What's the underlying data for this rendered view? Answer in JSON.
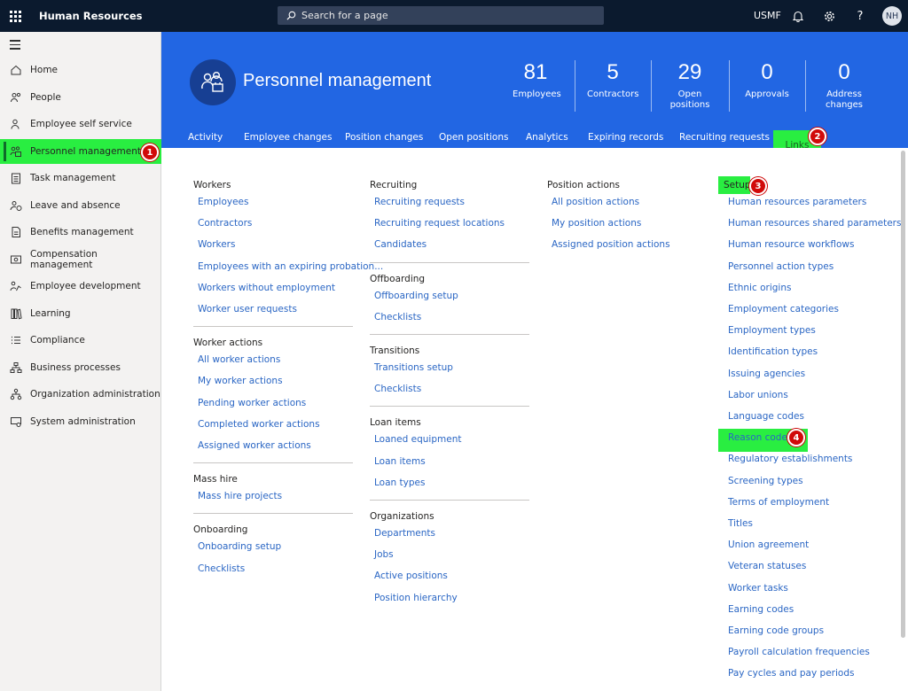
{
  "app": {
    "title": "Human Resources",
    "search_placeholder": "Search for a page",
    "company": "USMF",
    "user_initials": "NH"
  },
  "sidenav": {
    "items": [
      {
        "label": "Home",
        "icon": "home-icon"
      },
      {
        "label": "People",
        "icon": "people-icon"
      },
      {
        "label": "Employee self service",
        "icon": "person-icon"
      },
      {
        "label": "Personnel management",
        "icon": "personnel-icon",
        "active": true
      },
      {
        "label": "Task management",
        "icon": "clipboard-icon"
      },
      {
        "label": "Leave and absence",
        "icon": "person-clock-icon"
      },
      {
        "label": "Benefits management",
        "icon": "document-icon"
      },
      {
        "label": "Compensation management",
        "icon": "money-icon"
      },
      {
        "label": "Employee development",
        "icon": "growth-icon"
      },
      {
        "label": "Learning",
        "icon": "books-icon"
      },
      {
        "label": "Compliance",
        "icon": "list-icon"
      },
      {
        "label": "Business processes",
        "icon": "flow-icon"
      },
      {
        "label": "Organization administration",
        "icon": "org-icon"
      },
      {
        "label": "System administration",
        "icon": "system-icon"
      }
    ]
  },
  "banner": {
    "title": "Personnel management",
    "kpis": [
      {
        "value": "81",
        "label": "Employees"
      },
      {
        "value": "5",
        "label": "Contractors"
      },
      {
        "value": "29",
        "label": "Open positions"
      },
      {
        "value": "0",
        "label": "Approvals"
      },
      {
        "value": "0",
        "label_line1": "Address",
        "label_line2": "changes"
      }
    ],
    "tabs": [
      "Activity",
      "Employee changes",
      "Position changes",
      "Open positions",
      "Analytics",
      "Expiring records",
      "Recruiting requests",
      "Links"
    ]
  },
  "badges": [
    "1",
    "2",
    "3",
    "4"
  ],
  "links": {
    "col1": [
      {
        "title": "Workers",
        "items": [
          "Employees",
          "Contractors",
          "Workers",
          "Employees with an expiring probation...",
          "Workers without employment",
          "Worker user requests"
        ]
      },
      {
        "title": "Worker actions",
        "items": [
          "All worker actions",
          "My worker actions",
          "Pending worker actions",
          "Completed worker actions",
          "Assigned worker actions"
        ]
      },
      {
        "title": "Mass hire",
        "items": [
          "Mass hire projects"
        ]
      },
      {
        "title": "Onboarding",
        "items": [
          "Onboarding setup",
          "Checklists"
        ]
      }
    ],
    "col2": [
      {
        "title": "Recruiting",
        "items": [
          "Recruiting requests",
          "Recruiting request locations",
          "Candidates"
        ]
      },
      {
        "title": "Offboarding",
        "items": [
          "Offboarding setup",
          "Checklists"
        ]
      },
      {
        "title": "Transitions",
        "items": [
          "Transitions setup",
          "Checklists"
        ]
      },
      {
        "title": "Loan items",
        "items": [
          "Loaned equipment",
          "Loan items",
          "Loan types"
        ]
      },
      {
        "title": "Organizations",
        "items": [
          "Departments",
          "Jobs",
          "Active positions",
          "Position hierarchy"
        ]
      }
    ],
    "col3": [
      {
        "title": "Position actions",
        "items": [
          "All position actions",
          "My position actions",
          "Assigned position actions"
        ]
      }
    ],
    "col4": [
      {
        "title": "Setup",
        "items": [
          "Human resources parameters",
          "Human resources shared parameters",
          "Human resource workflows",
          "Personnel action types",
          "Ethnic origins",
          "Employment categories",
          "Employment types",
          "Identification types",
          "Issuing agencies",
          "Labor unions",
          "Language codes",
          "Reason codes",
          "Regulatory establishments",
          "Screening types",
          "Terms of employment",
          "Titles",
          "Union agreement",
          "Veteran statuses",
          "Worker tasks",
          "Earning codes",
          "Earning code groups",
          "Payroll calculation frequencies",
          "Pay cycles and pay periods"
        ]
      }
    ]
  },
  "colors": {
    "topbar": "#0b1a2e",
    "banner": "#2266e3",
    "highlight": "#29ee41",
    "badge": "#d10a0a",
    "link": "#2a66c4"
  }
}
